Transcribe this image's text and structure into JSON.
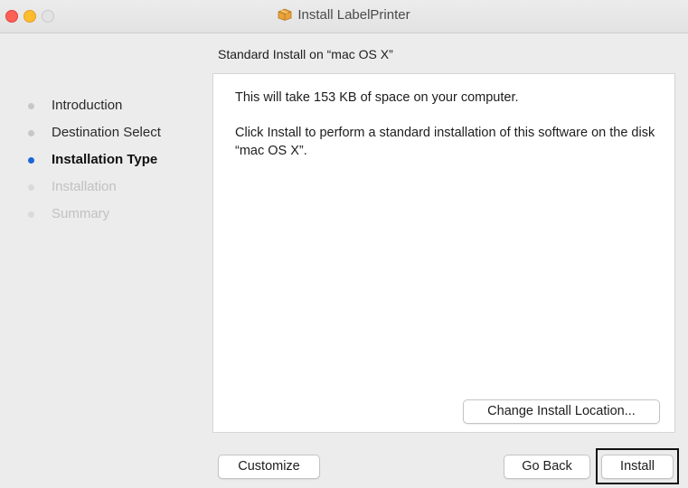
{
  "window": {
    "title": "Install LabelPrinter",
    "title_icon": "package-icon"
  },
  "subtitle": "Standard Install on “mac OS X”",
  "steps": [
    {
      "label": "Introduction",
      "state": "done"
    },
    {
      "label": "Destination Select",
      "state": "done"
    },
    {
      "label": "Installation Type",
      "state": "active"
    },
    {
      "label": "Installation",
      "state": "disabled"
    },
    {
      "label": "Summary",
      "state": "disabled"
    }
  ],
  "content": {
    "space_text": "This will take 153 KB of space on your computer.",
    "instruction_text": "Click Install to perform a standard installation of this software on the disk “mac OS X”.",
    "change_location_label": "Change Install Location..."
  },
  "buttons": {
    "customize": "Customize",
    "go_back": "Go Back",
    "install": "Install"
  },
  "colors": {
    "close": "#fe5f57",
    "minimize": "#febc2e",
    "maximize": "#e3e3e3",
    "active_step": "#1b66d6"
  }
}
